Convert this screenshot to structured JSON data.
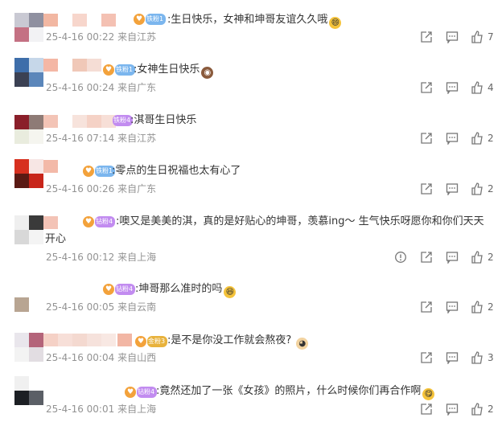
{
  "comments": [
    {
      "text": ":生日快乐，女神和坤哥友谊久久哦",
      "emoji": "party-face",
      "badge": "铁粉1",
      "badge_color": "blue",
      "time": "25-4-16 00:22",
      "location": "来自江苏",
      "likes": "7",
      "report": false,
      "reply": true
    },
    {
      "text": ":女神生日快乐",
      "emoji": "cake",
      "badge": "铁粉1",
      "badge_color": "blue",
      "time": "25-4-16 00:24",
      "location": "来自广东",
      "likes": "4",
      "report": false,
      "reply": true
    },
    {
      "text": ":淇哥生日快乐",
      "emoji": "",
      "badge": "铁粉4",
      "badge_color": "purple",
      "time": "25-4-16 07:14",
      "location": "来自江苏",
      "likes": "2",
      "report": false,
      "reply": true
    },
    {
      "text": ":零点的生日祝福也太有心了",
      "emoji": "",
      "badge": "铁粉1",
      "badge_color": "blue",
      "time": "25-4-16 00:26",
      "location": "来自广东",
      "likes": "2",
      "report": false,
      "reply": true
    },
    {
      "text": ":噢又是美美的淇，真的是好贴心的坤哥，羡慕ing～ 生气快乐呀愿你和你们天天",
      "text2": "开心",
      "emoji": "",
      "badge": "钻粉4",
      "badge_color": "purple",
      "time": "25-4-16 00:12",
      "location": "来自上海",
      "likes": "2",
      "report": true,
      "reply": true
    },
    {
      "text": ":坤哥那么准时的吗",
      "emoji": "laughing",
      "badge": "钻粉4",
      "badge_color": "purple",
      "time": "25-4-16 00:05",
      "location": "来自云南",
      "likes": "2",
      "report": false,
      "reply": true
    },
    {
      "text": ":是不是你没工作就会熬夜?",
      "emoji": "dog",
      "badge": "金粉3",
      "badge_color": "gold",
      "time": "25-4-16 00:04",
      "location": "来自山西",
      "likes": "3",
      "report": false,
      "reply": true
    },
    {
      "text": ":竟然还加了一张《女孩》的照片，什么时候你们再合作啊",
      "emoji": "tongue-face",
      "badge": "钻粉4",
      "badge_color": "purple",
      "time": "25-4-16 00:01",
      "location": "来自上海",
      "likes": "2",
      "report": false,
      "reply": true
    }
  ]
}
